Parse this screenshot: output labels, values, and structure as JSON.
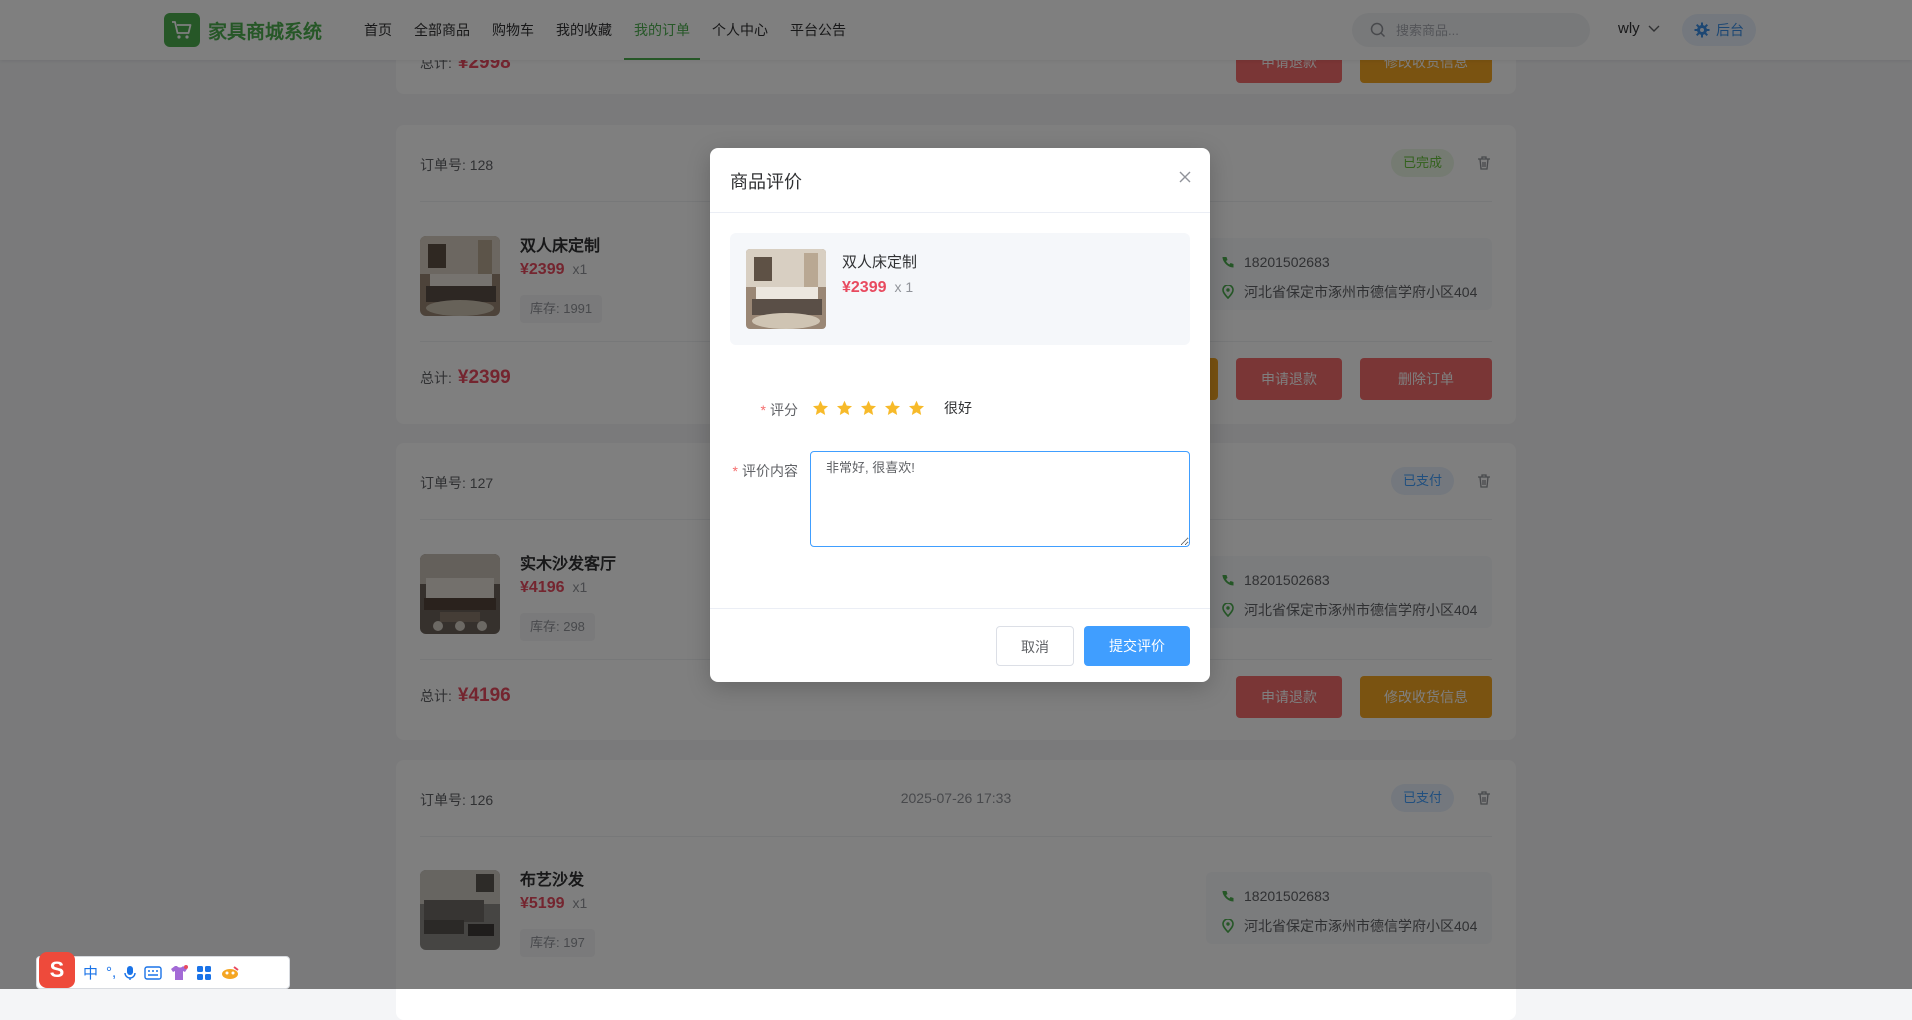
{
  "header": {
    "logo_text": "家具商城系统",
    "nav": [
      "首页",
      "全部商品",
      "购物车",
      "我的收藏",
      "我的订单",
      "个人中心",
      "平台公告"
    ],
    "search_placeholder": "搜索商品...",
    "username": "wly",
    "admin_label": "后台"
  },
  "partial_order": {
    "total_label": "总计:",
    "total_value": "¥2998",
    "refund_label": "申请退款",
    "modify_label": "修改收货信息"
  },
  "orders": [
    {
      "order_no": "订单号: 128",
      "status": "已完成",
      "product_name": "双人床定制",
      "price": "¥2399",
      "qty": "x1",
      "stock": "库存: 1991",
      "phone": "18201502683",
      "address": "河北省保定市涿州市德信学府小区404",
      "total_label": "总计:",
      "total_value": "¥2399",
      "refund_label": "申请退款",
      "delete_label": "删除订单"
    },
    {
      "order_no": "订单号: 127",
      "status": "已支付",
      "product_name": "实木沙发客厅",
      "price": "¥4196",
      "qty": "x1",
      "stock": "库存: 298",
      "phone": "18201502683",
      "address": "河北省保定市涿州市德信学府小区404",
      "total_label": "总计:",
      "total_value": "¥4196",
      "refund_label": "申请退款",
      "modify_label": "修改收货信息"
    },
    {
      "order_no": "订单号: 126",
      "time": "2025-07-26 17:33",
      "status": "已支付",
      "product_name": "布艺沙发",
      "price": "¥5199",
      "qty": "x1",
      "stock": "库存: 197",
      "phone": "18201502683",
      "address": "河北省保定市涿州市德信学府小区404"
    }
  ],
  "dialog": {
    "title": "商品评价",
    "product_name": "双人床定制",
    "price": "¥2399",
    "qty": "x 1",
    "rating_label": "评分",
    "rating_value": 5,
    "rating_max": 5,
    "rating_text": "很好",
    "content_label": "评价内容",
    "content_value": "非常好, 很喜欢!",
    "cancel_label": "取消",
    "submit_label": "提交评价"
  },
  "ime": {
    "logo": "S",
    "mode": "中",
    "punct": "°,"
  },
  "colors": {
    "brand_green": "#4cae4f",
    "price_red": "#e84a5f",
    "primary_blue": "#409eff",
    "refund_red": "#f56c6c",
    "modify_orange": "#f5a623",
    "star_orange": "#f7ba2a"
  }
}
